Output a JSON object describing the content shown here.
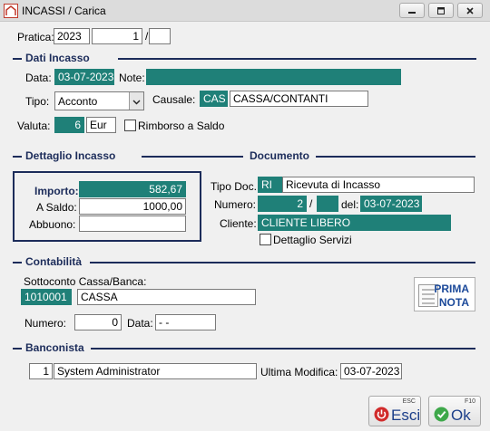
{
  "window": {
    "title": "INCASSI / Carica"
  },
  "pratica": {
    "label": "Pratica:",
    "anno": "2023",
    "numero": "1",
    "separatore": "/",
    "suffisso": ""
  },
  "dati_incasso": {
    "section_title": "Dati Incasso",
    "data_label": "Data:",
    "data_value": "03-07-2023",
    "note_label": "Note:",
    "note_value": "",
    "tipo_label": "Tipo:",
    "tipo_value": "Acconto",
    "causale_label": "Causale:",
    "causale_code": "CAS",
    "causale_desc": "CASSA/CONTANTI",
    "valuta_label": "Valuta:",
    "valuta_code": "6",
    "valuta_desc": "Eur",
    "rimborso_label": "Rimborso a Saldo",
    "rimborso_checked": false
  },
  "dettaglio_incasso": {
    "section_title": "Dettaglio Incasso",
    "importo_label": "Importo:",
    "importo_value": "582,67",
    "saldo_label": "A Saldo:",
    "saldo_value": "1000,00",
    "abbuono_label": "Abbuono:",
    "abbuono_value": ""
  },
  "documento": {
    "section_title": "Documento",
    "tipo_doc_label": "Tipo Doc.",
    "tipo_doc_code": "RI",
    "tipo_doc_desc": "Ricevuta di Incasso",
    "numero_label": "Numero:",
    "numero_value": "2",
    "numero_sep": "/",
    "numero_suffix": "",
    "del_label": "del:",
    "del_value": "03-07-2023",
    "cliente_label": "Cliente:",
    "cliente_value": "CLIENTE LIBERO",
    "dettaglio_servizi_label": "Dettaglio Servizi",
    "dettaglio_servizi_checked": false
  },
  "contabilita": {
    "section_title": "Contabilità",
    "sottoconto_label": "Sottoconto Cassa/Banca:",
    "sottoconto_code": "1010001",
    "sottoconto_desc": "CASSA",
    "numero_label": "Numero:",
    "numero_value": "0",
    "data_label": "Data:",
    "data_value": "- -",
    "prima_nota_line1": "PRIMA",
    "prima_nota_line2": "NOTA"
  },
  "banconista": {
    "section_title": "Banconista",
    "id": "1",
    "name": "System Administrator",
    "ultima_modifica_label": "Ultima Modifica:",
    "ultima_modifica_value": "03-07-2023"
  },
  "buttons": {
    "esci_label": "Esci",
    "esci_key": "ESC",
    "ok_label": "Ok",
    "ok_key": "F10"
  },
  "colors": {
    "teal_field": "#1f8078",
    "section_navy": "#1c2c5a",
    "button_text": "#1c3f8a"
  },
  "icons": [
    "app-icon",
    "minimize-icon",
    "restore-icon",
    "close-icon",
    "chevron-down-icon",
    "prima-nota-icon",
    "power-icon",
    "check-icon"
  ]
}
